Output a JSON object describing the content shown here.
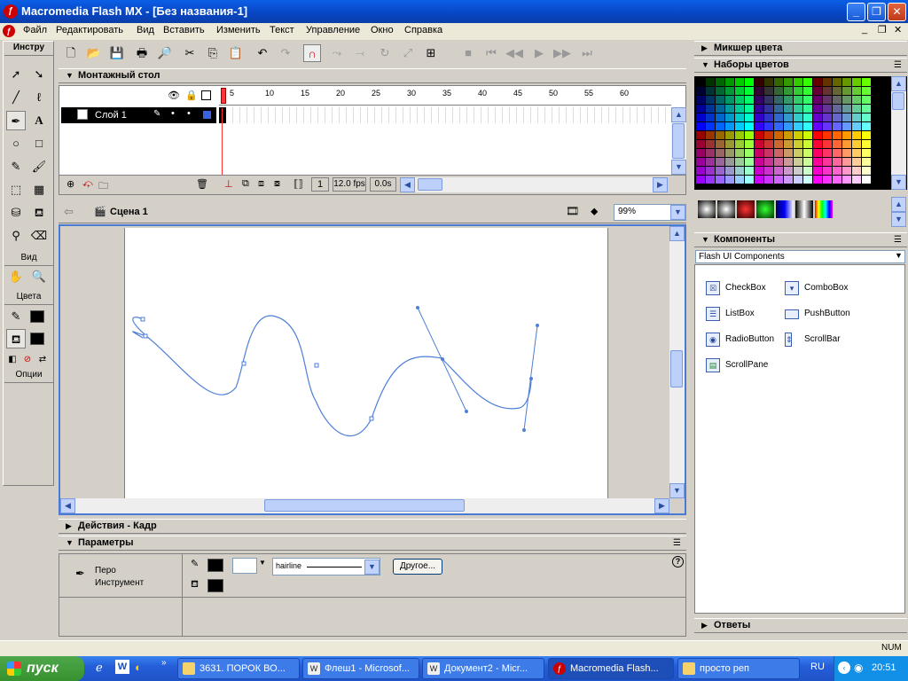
{
  "title_bar": {
    "text": "Macromedia Flash MX - [Без названия-1]",
    "min_label": "_",
    "max_label": "❐",
    "close_label": "✕"
  },
  "menu": {
    "items": [
      "Файл",
      "Редактировать",
      "Вид",
      "Вставить",
      "Изменить",
      "Текст",
      "Управление",
      "Окно",
      "Справка"
    ]
  },
  "tools_panel": {
    "title": "Инстру",
    "view_label": "Вид",
    "colors_label": "Цвета",
    "options_label": "Опции"
  },
  "timeline_panel": {
    "title": "Монтажный стол",
    "layer_name": "Слой 1",
    "ruler_ticks": [
      "1",
      "5",
      "10",
      "15",
      "20",
      "25",
      "30",
      "35",
      "40",
      "45",
      "50",
      "55",
      "60"
    ],
    "current_frame": "1",
    "fps": "12.0 fps",
    "elapsed": "0.0s"
  },
  "stage": {
    "scene_label": "Сцена 1",
    "zoom": "99%"
  },
  "actions_panel": {
    "title": "Действия - Кадр"
  },
  "properties_panel": {
    "title": "Параметры",
    "tool_name": "Перо",
    "tool_type": "Инструмент",
    "stroke_style": "hairline",
    "other_button": "Другое...",
    "help": "?"
  },
  "right_panels": {
    "color_mixer_title": "Микшер цвета",
    "color_swatches_title": "Наборы цветов",
    "components_title": "Компоненты",
    "components_set": "Flash UI Components",
    "components": [
      {
        "name": "CheckBox",
        "icon": "checkbox-icon"
      },
      {
        "name": "ComboBox",
        "icon": "combobox-icon"
      },
      {
        "name": "ListBox",
        "icon": "listbox-icon"
      },
      {
        "name": "PushButton",
        "icon": "pushbutton-icon"
      },
      {
        "name": "RadioButton",
        "icon": "radiobutton-icon"
      },
      {
        "name": "ScrollBar",
        "icon": "scrollbar-icon"
      },
      {
        "name": "ScrollPane",
        "icon": "scrollpane-icon"
      }
    ],
    "answers_title": "Ответы"
  },
  "status_bar": {
    "num": "NUM"
  },
  "taskbar": {
    "start_label": "пуск",
    "tasks": [
      {
        "label": "3631. ПОРОК ВО...",
        "icon": "folder-icon",
        "active": false
      },
      {
        "label": "Флеш1 - Microsof...",
        "icon": "word-icon",
        "active": false
      },
      {
        "label": "Документ2 - Micr...",
        "icon": "word-icon",
        "active": false
      },
      {
        "label": "Macromedia Flash...",
        "icon": "flash-icon",
        "active": true
      },
      {
        "label": "просто реп",
        "icon": "folder-icon",
        "active": false
      }
    ],
    "lang": "RU",
    "clock": "20:51"
  },
  "colors": {
    "accent": "#0a5fe6",
    "curve": "#4f7fd8",
    "selection": "#4a7bd4"
  }
}
